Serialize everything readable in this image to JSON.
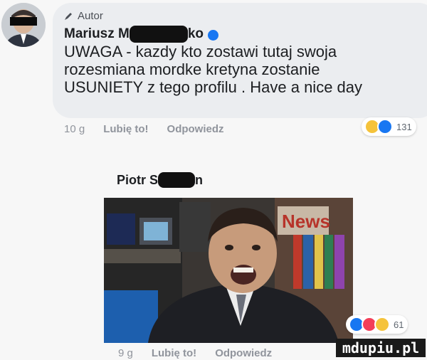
{
  "comment": {
    "author_badge": "Autor",
    "author_name_start": "Mariusz M",
    "author_name_end": "ko",
    "lines": [
      "UWAGA - kazdy kto zostawi tutaj swoja",
      "rozesmiana mordke kretyna zostanie",
      "USUNIETY z tego profilu . Have a nice day"
    ],
    "time": "10 g",
    "like_label": "Lubię to!",
    "reply_label": "Odpowiedz",
    "reaction_count": "131",
    "reactions": [
      "haha-icon",
      "like-icon"
    ]
  },
  "reply": {
    "author_name_start": "Piotr S",
    "author_name_end": "n",
    "photo_caption": "News",
    "time": "9 g",
    "like_label": "Lubię to!",
    "reply_label": "Odpowiedz",
    "reaction_count": "61",
    "reactions": [
      "like-icon",
      "love-icon",
      "haha-icon"
    ]
  },
  "watermark": "mdupiu.pl",
  "colors": {
    "bubble": "#ebedf0",
    "like_blue": "#1877f2",
    "love_red": "#f33e58",
    "haha_yellow": "#f5c33b"
  }
}
